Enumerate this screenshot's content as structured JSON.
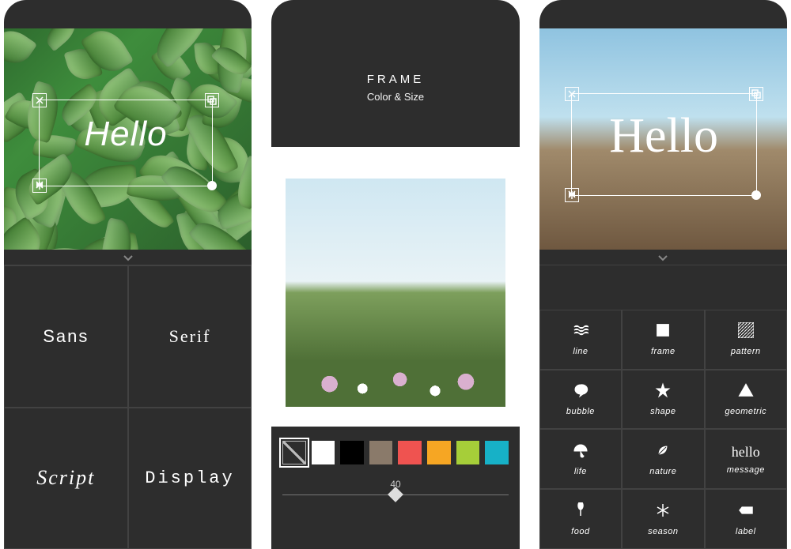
{
  "phone1": {
    "text_overlay": "Hello",
    "fonts": [
      "Sans",
      "Serif",
      "Script",
      "Display"
    ]
  },
  "phone2": {
    "panel_title": "FRAME",
    "panel_subtitle": "Color & Size",
    "swatches": [
      "none",
      "#ffffff",
      "#000000",
      "#8a7a6a",
      "#ef5350",
      "#f6a623",
      "#a6ce39",
      "#17b1c7"
    ],
    "selected_swatch": 0,
    "slider_value": "40",
    "slider_percent": 50
  },
  "phone3": {
    "text_overlay": "Hello",
    "tools": [
      {
        "id": "line",
        "label": "line",
        "icon": "waves"
      },
      {
        "id": "frame",
        "label": "frame",
        "icon": "frame"
      },
      {
        "id": "pattern",
        "label": "pattern",
        "icon": "pattern"
      },
      {
        "id": "bubble",
        "label": "bubble",
        "icon": "bubble"
      },
      {
        "id": "shape",
        "label": "shape",
        "icon": "star"
      },
      {
        "id": "geometric",
        "label": "geometric",
        "icon": "triangle"
      },
      {
        "id": "life",
        "label": "life",
        "icon": "umbrella"
      },
      {
        "id": "nature",
        "label": "nature",
        "icon": "leaf"
      },
      {
        "id": "message",
        "label": "message",
        "icon": "script",
        "msg": "hello"
      },
      {
        "id": "food",
        "label": "food",
        "icon": "food"
      },
      {
        "id": "season",
        "label": "season",
        "icon": "snow"
      },
      {
        "id": "label",
        "label": "label",
        "icon": "tag"
      }
    ]
  }
}
